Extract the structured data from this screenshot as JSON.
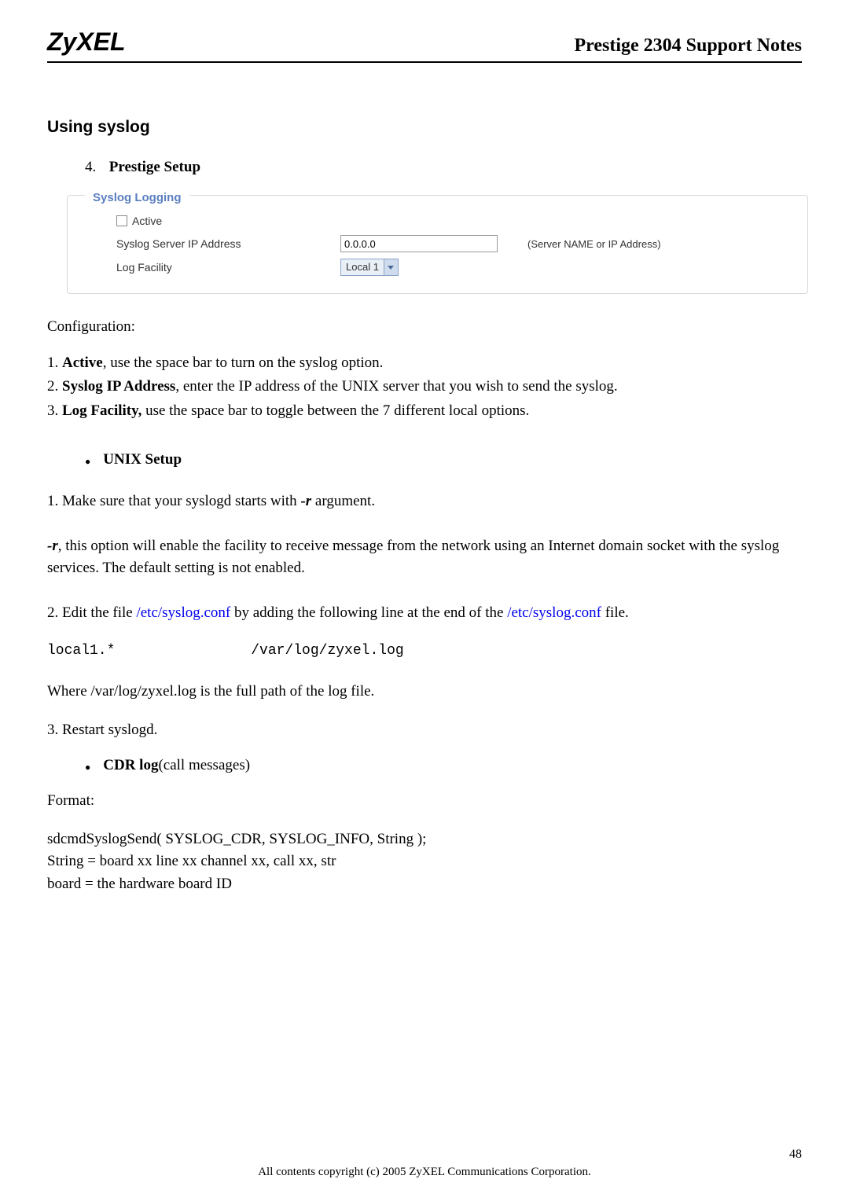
{
  "header": {
    "logo": "ZyXEL",
    "doc_title": "Prestige 2304 Support Notes"
  },
  "section": {
    "title": "Using syslog"
  },
  "list1": {
    "num": "4.",
    "label": "Prestige Setup"
  },
  "panel": {
    "legend": "Syslog Logging",
    "active_label": "Active",
    "ip_label": "Syslog Server IP Address",
    "ip_value": "0.0.0.0",
    "ip_hint": "(Server NAME or IP Address)",
    "facility_label": "Log Facility",
    "facility_value": "Local 1"
  },
  "config": {
    "heading": "Configuration:",
    "line1_prefix": "1. ",
    "line1_bold": "Active",
    "line1_rest": ", use the space bar to turn on the syslog option.",
    "line2_prefix": "2. ",
    "line2_bold": "Syslog IP Address",
    "line2_rest": ", enter the IP address of the UNIX server that you wish to send the syslog.",
    "line3_prefix": "3. ",
    "line3_bold": "Log Facility,",
    "line3_rest": " use the space bar to toggle between the 7 different local options."
  },
  "unix": {
    "label": "UNIX Setup",
    "p1a": "1. Make sure that your syslogd starts with ",
    "p1_flag": "-r",
    "p1b": " argument.",
    "p2_flag": "-r",
    "p2_rest": ", this option will enable the facility to receive message from the network using an Internet domain socket with the syslog services. The default setting is not enabled.",
    "p3a": "2. Edit the file ",
    "p3_link": "/etc/syslog.conf",
    "p3b": " by adding the following line at the end of the ",
    "p3c": " file.",
    "code": "local1.*                /var/log/zyxel.log",
    "p4": "Where /var/log/zyxel.log is the full path of the log file.",
    "p5": "3. Restart syslogd."
  },
  "cdr": {
    "label_bold": "CDR log",
    "label_rest": "(call messages)",
    "format_label": "Format:",
    "l1": "sdcmdSyslogSend( SYSLOG_CDR, SYSLOG_INFO, String );",
    "l2": "String = board xx line xx channel xx, call xx, str",
    "l3": "board = the hardware board ID"
  },
  "footer": {
    "copyright": "All contents copyright (c) 2005 ZyXEL Communications Corporation.",
    "page": "48"
  }
}
